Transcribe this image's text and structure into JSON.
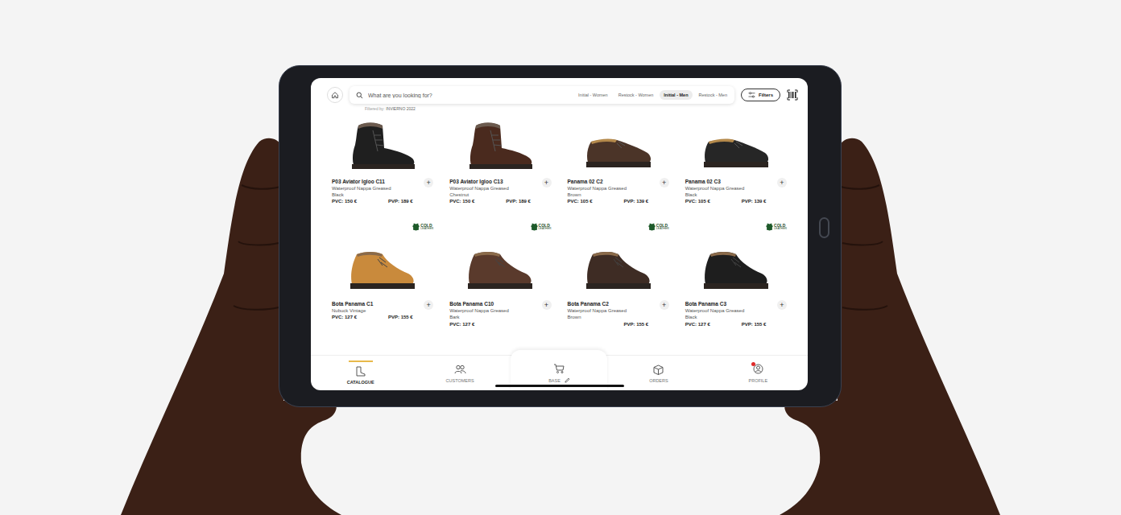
{
  "search": {
    "placeholder": "What are you looking for?"
  },
  "chips": [
    {
      "label": "Initial - Women",
      "selected": false
    },
    {
      "label": "Restock - Women",
      "selected": false
    },
    {
      "label": "Initial - Men",
      "selected": true
    },
    {
      "label": "Restock - Men",
      "selected": false
    }
  ],
  "filters_button": "Filters",
  "filter_note": {
    "prefix": "Filtered by:",
    "value": "INVIERNO 2022"
  },
  "add_label": "+",
  "badge": {
    "top": "COLD",
    "bottom": "LEATHER"
  },
  "products": [
    {
      "name": "P03 Aviator Igloo C11",
      "description": [
        "Waterproof Nappa Greased",
        "Black"
      ],
      "pvc": "PVC: 150 €",
      "pvp": "PVP: 189 €",
      "badge": false,
      "kind": "boot",
      "color": "#1f1f1f"
    },
    {
      "name": "P03 Aviator Igloo C13",
      "description": [
        "Waterproof Nappa Greased",
        "Chestnut"
      ],
      "pvc": "PVC: 150 €",
      "pvp": "PVP: 189 €",
      "badge": false,
      "kind": "boot",
      "color": "#4a2a1e"
    },
    {
      "name": "Panama 02 C2",
      "description": [
        "Waterproof Nappa Greased",
        "Brown"
      ],
      "pvc": "PVC: 105 €",
      "pvp": "PVP: 139 €",
      "badge": false,
      "kind": "shoe",
      "color": "#4b3428"
    },
    {
      "name": "Panama 02 C3",
      "description": [
        "Waterproof Nappa Greased",
        "Black"
      ],
      "pvc": "PVC: 105 €",
      "pvp": "PVP: 139 €",
      "badge": false,
      "kind": "shoe",
      "color": "#262626"
    },
    {
      "name": "Bota Panama C1",
      "description": [
        "Nubuck Vintage"
      ],
      "pvc": "PVC: 127 €",
      "pvp": "PVP: 155 €",
      "badge": true,
      "kind": "chukka",
      "color": "#c98a3c"
    },
    {
      "name": "Bota Panama C10",
      "description": [
        "Waterproof Nappa Greased",
        "Bark"
      ],
      "pvc": "PVC: 127 €",
      "badge": true,
      "kind": "chukka",
      "color": "#5a3a2c"
    },
    {
      "name": "Bota Panama C2",
      "description": [
        "Waterproof Nappa Greased",
        "Brown"
      ],
      "pvp": "PVP: 155 €",
      "badge": true,
      "kind": "chukka",
      "color": "#3e2c24"
    },
    {
      "name": "Bota Panama C3",
      "description": [
        "Waterproof Nappa Greased",
        "Black"
      ],
      "pvc": "PVC: 127 €",
      "pvp": "PVP: 155 €",
      "badge": true,
      "kind": "chukka",
      "color": "#1e1e1e"
    }
  ],
  "nav": [
    {
      "label": "CATALOGUE",
      "selected": true
    },
    {
      "label": "CUSTOMERS",
      "selected": false
    },
    {
      "label": "BASE",
      "selected": false
    },
    {
      "label": "ORDERS",
      "selected": false
    },
    {
      "label": "PROFILE",
      "selected": false
    }
  ]
}
